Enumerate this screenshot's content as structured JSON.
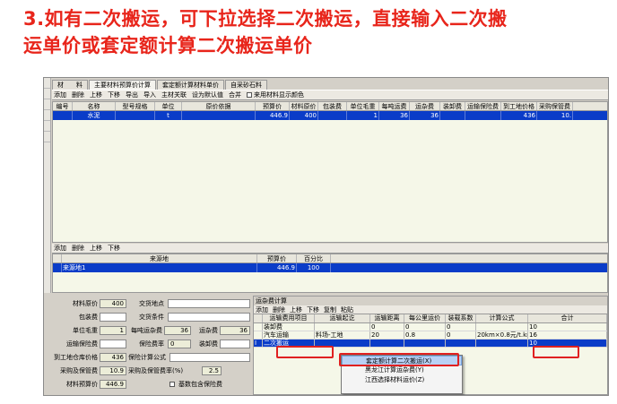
{
  "headline": {
    "line1": "3.如有二次搬运，可下拉选择二次搬运，直接输入二次搬",
    "line2": "运单价或套定额计算二次搬运单价"
  },
  "left_strip": [
    "",
    "",
    "",
    "",
    "",
    "",
    "",
    ""
  ],
  "tabs": [
    {
      "label": "材　　料",
      "active": false
    },
    {
      "label": "主要材料预算价计算",
      "active": true
    },
    {
      "label": "套定额计算材料单价",
      "active": false
    },
    {
      "label": "自采砂石料",
      "active": false
    }
  ],
  "toolbar": {
    "items": [
      "添加",
      "删除",
      "上移",
      "下移",
      "导出",
      "导入",
      "主材关联",
      "设为默认值",
      "合并"
    ],
    "checkbox_label": "来用材料显示颜色"
  },
  "material_table": {
    "headers": [
      "编号",
      "名称",
      "型号规格",
      "单位",
      "原价依据",
      "预算价",
      "材料原价",
      "包装费",
      "单位毛重",
      "每吨运费",
      "运杂费",
      "装卸费",
      "运输保险费",
      "到工地价格",
      "采购保管费"
    ],
    "rows": [
      [
        "",
        "水泥",
        "",
        "t",
        "",
        "446.9",
        "400",
        "",
        "1",
        "36",
        "36",
        "",
        "",
        "436",
        "10."
      ]
    ]
  },
  "toolbar2": {
    "items": [
      "添加",
      "删除",
      "上移",
      "下移"
    ]
  },
  "source_table": {
    "headers": [
      "",
      "来源地",
      "预算价",
      "百分比"
    ],
    "rows": [
      [
        "",
        "来源地1",
        "446.9",
        "100"
      ]
    ]
  },
  "form": {
    "labels": {
      "material_price": "材料原价",
      "packing_fee": "包装费",
      "unit_weight": "单位毛重",
      "transport_insurance": "运输保险费",
      "site_warehouse_price": "到工地仓库价格",
      "procurement_fee": "采购及保管费",
      "budget_price": "材料预算价",
      "delivery_place": "交货地点",
      "delivery_terms": "交货条件",
      "freight_per_ton": "每吨运杂费",
      "freight": "运杂费",
      "insurance_rate": "保险费率",
      "loading_fee": "装卸费",
      "insurance_formula": "保险计算公式",
      "procurement_rate": "采购及保管费率(%)",
      "include_insurance": "基数包含保险费"
    },
    "values": {
      "material_price": "400",
      "packing_fee": "",
      "unit_weight": "1",
      "transport_insurance": "",
      "site_warehouse_price": "436",
      "procurement_fee": "10.9",
      "budget_price": "446.9",
      "delivery_place": "",
      "delivery_terms": "",
      "freight_per_ton": "36",
      "freight": "36",
      "insurance_rate": "0",
      "loading_fee": "",
      "insurance_formula": "",
      "procurement_rate": "2.5"
    }
  },
  "freight_panel": {
    "title": "运杂费计算",
    "toolbar": [
      "添加",
      "删除",
      "上移",
      "下移",
      "复制",
      "粘贴"
    ],
    "headers": [
      "",
      "运输费用项目",
      "运输起讫",
      "运输距离",
      "每公里运价",
      "装载系数",
      "计算公式",
      "合计"
    ],
    "rows": [
      [
        "",
        "装卸费",
        "",
        "0",
        "0",
        "0",
        "",
        "10"
      ],
      [
        "",
        "汽车运输",
        "料场-工地",
        "20",
        "0.8",
        "0",
        "20km×0.8元/t.km",
        "16"
      ],
      [
        "I",
        "二次搬运",
        "",
        "",
        "",
        "",
        "",
        "10"
      ]
    ]
  },
  "context_menu": {
    "items": [
      {
        "label": "套定额计算二次搬运(X)",
        "highlighted": true
      },
      {
        "label": "黑龙江计算运杂费(Y)",
        "highlighted": false
      },
      {
        "label": "江西选择材料运价(Z)",
        "highlighted": false
      }
    ]
  },
  "colors": {
    "headline": "#e8251b",
    "selection": "#0a3cc8",
    "annotation_box": "#e02020"
  }
}
